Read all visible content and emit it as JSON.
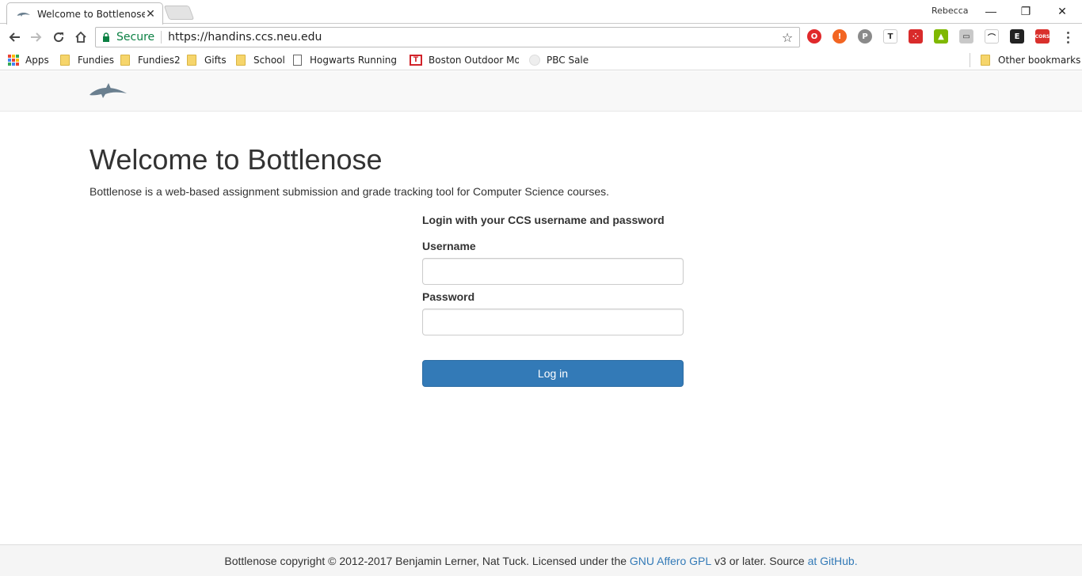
{
  "browser": {
    "tab_title": "Welcome to Bottlenose -",
    "profile_name": "Rebecca",
    "secure_label": "Secure",
    "url": "https://handins.ccs.neu.edu",
    "bookmarks": [
      {
        "label": "Apps",
        "kind": "apps"
      },
      {
        "label": "Fundies",
        "kind": "folder"
      },
      {
        "label": "Fundies2",
        "kind": "folder"
      },
      {
        "label": "Gifts",
        "kind": "folder"
      },
      {
        "label": "School",
        "kind": "folder"
      },
      {
        "label": "Hogwarts Running Cl",
        "kind": "page"
      },
      {
        "label": "Boston Outdoor Mov",
        "kind": "site"
      },
      {
        "label": "PBC Sale",
        "kind": "site"
      }
    ],
    "other_bookmarks": "Other bookmarks",
    "extensions": [
      {
        "name": "opera-icon",
        "color": "#e0292b",
        "glyph": "O"
      },
      {
        "name": "alert-extension-icon",
        "color": "#f26522",
        "glyph": "!"
      },
      {
        "name": "pinterest-icon",
        "color": "#8a8a8a",
        "glyph": "P"
      },
      {
        "name": "tab-extension-icon",
        "color": "#ffffff",
        "glyph": "T"
      },
      {
        "name": "dice-extension-icon",
        "color": "#d92b2b",
        "glyph": "⁘"
      },
      {
        "name": "plant-extension-icon",
        "color": "#7fb800",
        "glyph": "▲"
      },
      {
        "name": "screenshot-extension-icon",
        "color": "#c8c8c8",
        "glyph": "▭"
      },
      {
        "name": "arc-extension-icon",
        "color": "#ffffff",
        "glyph": "⌒"
      },
      {
        "name": "evernote-extension-icon",
        "color": "#222222",
        "glyph": "E"
      },
      {
        "name": "cors-extension-icon",
        "color": "#d9302c",
        "glyph": "CORS"
      }
    ]
  },
  "page": {
    "heading": "Welcome to Bottlenose",
    "lead": "Bottlenose is a web-based assignment submission and grade tracking tool for Computer Science courses.",
    "login": {
      "title": "Login with your CCS username and password",
      "username_label": "Username",
      "username_value": "",
      "password_label": "Password",
      "password_value": "",
      "submit_label": "Log in"
    },
    "footer": {
      "prefix": "Bottlenose copyright © 2012-2017 Benjamin Lerner, Nat Tuck. Licensed under the ",
      "license_link": "GNU Affero GPL",
      "middle": " v3 or later. Source ",
      "source_link": "at GitHub."
    }
  },
  "colors": {
    "primary_button": "#337ab7",
    "link": "#337ab7",
    "secure_green": "#0b8043"
  }
}
